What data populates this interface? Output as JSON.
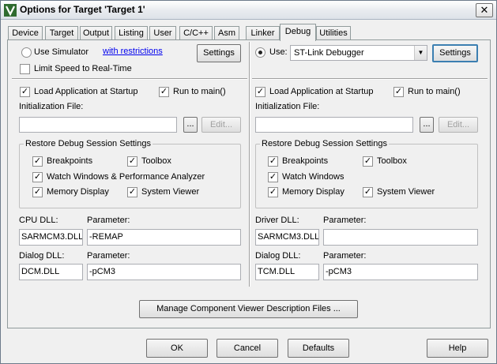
{
  "window": {
    "title": "Options for Target 'Target 1'",
    "close_glyph": "✕"
  },
  "tabs": [
    {
      "label": "Device"
    },
    {
      "label": "Target"
    },
    {
      "label": "Output"
    },
    {
      "label": "Listing"
    },
    {
      "label": "User"
    },
    {
      "label": "C/C++"
    },
    {
      "label": "Asm"
    },
    {
      "label": "Linker"
    },
    {
      "label": "Debug",
      "active": true
    },
    {
      "label": "Utilities"
    }
  ],
  "left": {
    "use_simulator": "Use Simulator",
    "restrictions_link": "with restrictions",
    "settings": "Settings",
    "limit_speed": "Limit Speed to Real-Time",
    "load_app": "Load Application at Startup",
    "run_to_main": "Run to main()",
    "init_file_label": "Initialization File:",
    "browse": "...",
    "edit": "Edit...",
    "restore_title": "Restore Debug Session Settings",
    "breakpoints": "Breakpoints",
    "toolbox": "Toolbox",
    "watch_windows": "Watch Windows & Performance Analyzer",
    "memory_display": "Memory Display",
    "system_viewer": "System Viewer",
    "cpu_dll_label": "CPU DLL:",
    "cpu_dll_value": "SARMCM3.DLL",
    "cpu_param_label": "Parameter:",
    "cpu_param_value": "-REMAP",
    "dialog_dll_label": "Dialog DLL:",
    "dialog_dll_value": "DCM.DLL",
    "dialog_param_label": "Parameter:",
    "dialog_param_value": "-pCM3"
  },
  "right": {
    "use": "Use:",
    "debugger": "ST-Link Debugger",
    "settings": "Settings",
    "load_app": "Load Application at Startup",
    "run_to_main": "Run to main()",
    "init_file_label": "Initialization File:",
    "browse": "...",
    "edit": "Edit...",
    "restore_title": "Restore Debug Session Settings",
    "breakpoints": "Breakpoints",
    "toolbox": "Toolbox",
    "watch_windows": "Watch Windows",
    "memory_display": "Memory Display",
    "system_viewer": "System Viewer",
    "driver_dll_label": "Driver DLL:",
    "driver_dll_value": "SARMCM3.DLL",
    "driver_param_label": "Parameter:",
    "driver_param_value": "",
    "dialog_dll_label": "Dialog DLL:",
    "dialog_dll_value": "TCM.DLL",
    "dialog_param_label": "Parameter:",
    "dialog_param_value": "-pCM3"
  },
  "manage_button": "Manage Component Viewer Description Files ...",
  "footer": {
    "ok": "OK",
    "cancel": "Cancel",
    "defaults": "Defaults",
    "help": "Help"
  },
  "checkmark": "✓",
  "combo_arrow": "▼"
}
